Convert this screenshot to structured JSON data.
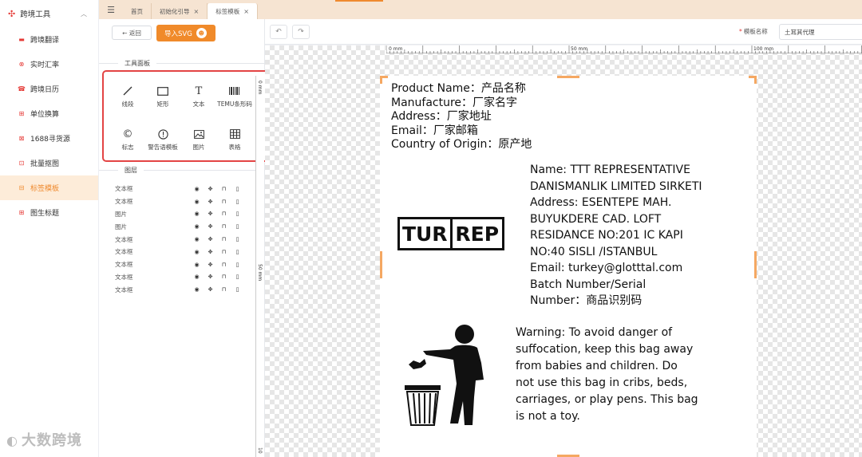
{
  "sidebar": {
    "group_label": "跨境工具",
    "items": [
      {
        "label": "跨境翻译",
        "icon": "translate-icon"
      },
      {
        "label": "实时汇率",
        "icon": "exchange-icon"
      },
      {
        "label": "跨境日历",
        "icon": "calendar-icon"
      },
      {
        "label": "单位换算",
        "icon": "unit-convert-icon"
      },
      {
        "label": "1688寻货源",
        "icon": "source-icon"
      },
      {
        "label": "批量抠图",
        "icon": "cutout-icon"
      },
      {
        "label": "标签模板",
        "icon": "label-template-icon",
        "active": true
      },
      {
        "label": "图生标题",
        "icon": "image-title-icon"
      }
    ]
  },
  "tabs": [
    {
      "label": "首页",
      "closable": false
    },
    {
      "label": "初始化引导",
      "closable": true
    },
    {
      "label": "标签模板",
      "closable": true,
      "active": true
    }
  ],
  "panel": {
    "back_label": "← 返回",
    "import_label": "导入SVG",
    "tools_title": "工具面板",
    "tools": [
      {
        "label": "线段",
        "icon": "line-icon"
      },
      {
        "label": "矩形",
        "icon": "rectangle-icon"
      },
      {
        "label": "文本",
        "icon": "text-icon"
      },
      {
        "label": "TEMU条形码",
        "icon": "barcode-icon"
      },
      {
        "label": "标志",
        "icon": "copyright-icon"
      },
      {
        "label": "警告语模板",
        "icon": "warning-icon"
      },
      {
        "label": "图片",
        "icon": "image-icon"
      },
      {
        "label": "表格",
        "icon": "table-icon"
      }
    ],
    "layers_title": "图层",
    "layers": [
      "文本框",
      "文本框",
      "图片",
      "图片",
      "文本框",
      "文本框",
      "文本框",
      "文本框",
      "文本框"
    ]
  },
  "toolbar": {
    "template_label": "模板名称",
    "template_value": "土耳其代理"
  },
  "rulers": {
    "top": [
      "0 mm",
      "50 mm",
      "100 mm"
    ],
    "left": [
      "0 mm",
      "50 mm",
      "10"
    ]
  },
  "label": {
    "product_lines": "Product Name：产品名称\nManufacture：厂家名字\nAddress：厂家地址\nEmail：厂家邮箱\nCountry of Origin：原产地",
    "tur": "TUR",
    "rep": "REP",
    "rep_lines": "Name: TTT REPRESENTATIVE\nDANISMANLIK LIMITED SIRKETI\nAddress: ESENTEPE MAH.\nBUYUKDERE CAD. LOFT\nRESIDANCE NO:201 IC KAPI\nNO:40 SISLI /ISTANBUL\nEmail: turkey@glotttal.com\nBatch Number/Serial\nNumber：商品识别码",
    "warning_lines": "Warning: To avoid danger of\nsuffocation, keep this bag away\nfrom babies and children. Do\nnot use this bag in cribs, beds,\ncarriages, or play pens. This bag\nis not a toy."
  },
  "watermark": "大数跨境"
}
